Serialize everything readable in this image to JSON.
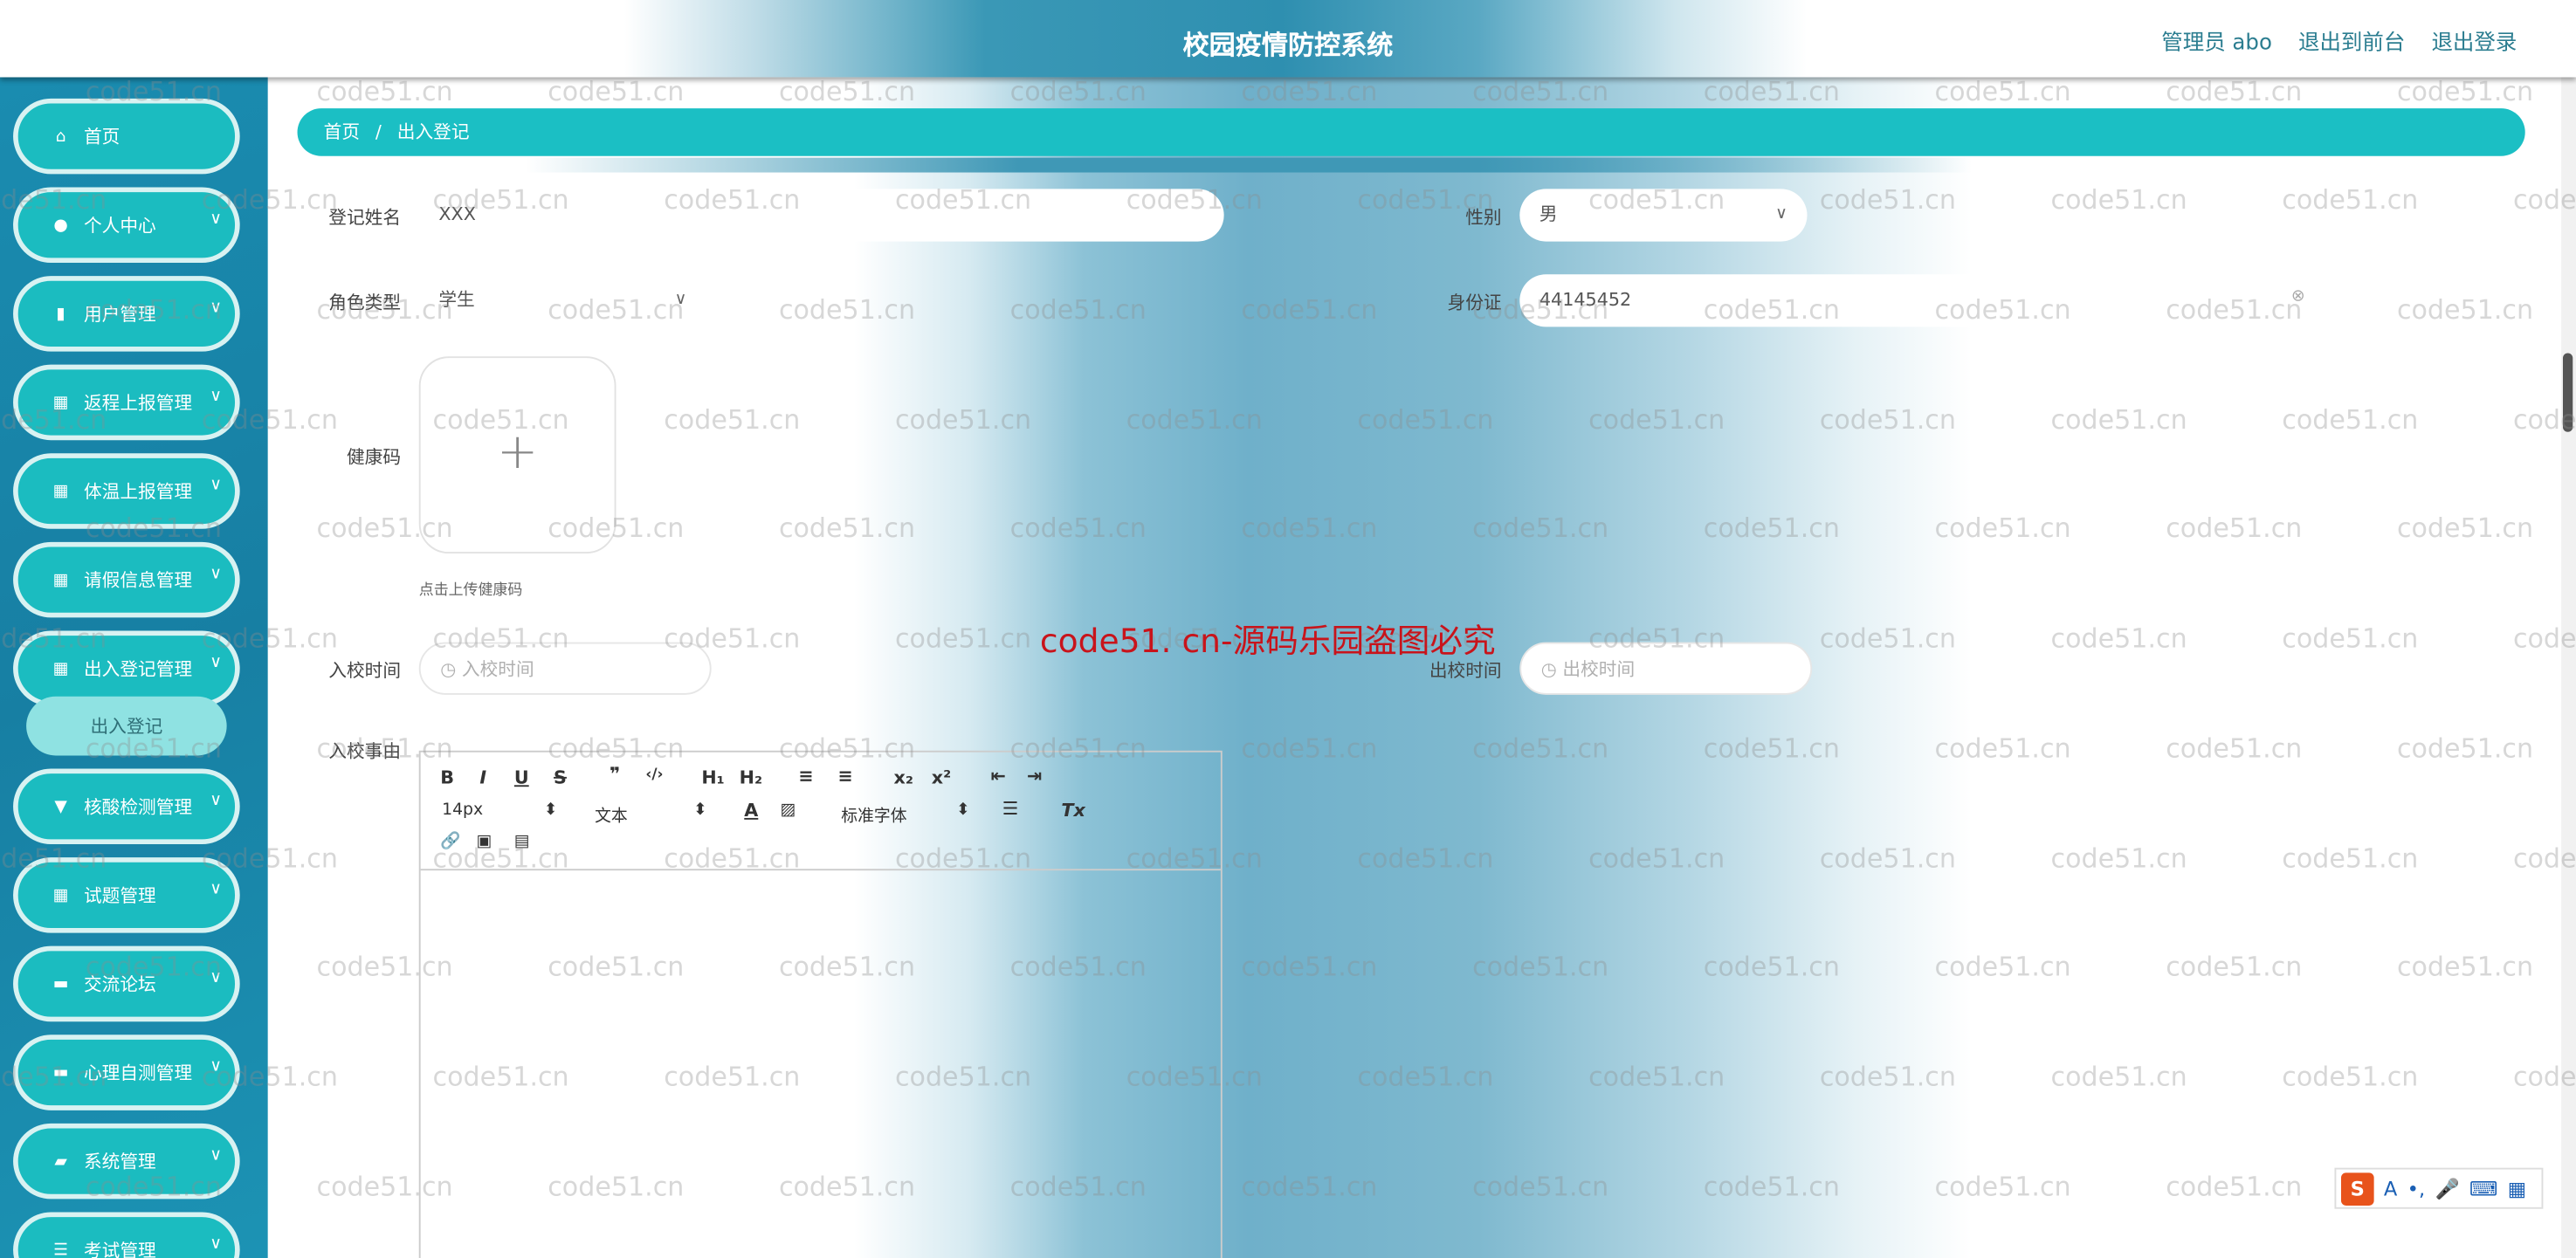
{
  "header": {
    "title": "校园疫情防控系统",
    "user": "管理员 abo",
    "to_front": "退出到前台",
    "logout": "退出登录"
  },
  "sidebar": {
    "items": [
      {
        "label": "首页",
        "icon": "home-icon",
        "glyph": "⌂",
        "chev": false
      },
      {
        "label": "个人中心",
        "icon": "user-icon",
        "glyph": "●",
        "chev": true
      },
      {
        "label": "用户管理",
        "icon": "clipboard-icon",
        "glyph": "▮",
        "chev": true
      },
      {
        "label": "返程上报管理",
        "icon": "grid-icon",
        "glyph": "▦",
        "chev": true
      },
      {
        "label": "体温上报管理",
        "icon": "grid-icon",
        "glyph": "▦",
        "chev": true
      },
      {
        "label": "请假信息管理",
        "icon": "grid-icon",
        "glyph": "▦",
        "chev": true
      },
      {
        "label": "出入登记管理",
        "icon": "grid-icon",
        "glyph": "▦",
        "chev": true
      },
      {
        "label": "核酸检测管理",
        "icon": "test-tube-icon",
        "glyph": "▼",
        "chev": true
      },
      {
        "label": "试题管理",
        "icon": "grid-icon",
        "glyph": "▦",
        "chev": true
      },
      {
        "label": "交流论坛",
        "icon": "forum-icon",
        "glyph": "▬",
        "chev": true
      },
      {
        "label": "心理自测管理",
        "icon": "chat-icon",
        "glyph": "▬",
        "chev": true
      },
      {
        "label": "系统管理",
        "icon": "briefcase-icon",
        "glyph": "▰",
        "chev": true
      },
      {
        "label": "考试管理",
        "icon": "list-icon",
        "glyph": "☰",
        "chev": true
      }
    ],
    "sub_item": "出入登记"
  },
  "breadcrumb": {
    "home": "首页",
    "sep": "/",
    "current": "出入登记"
  },
  "form": {
    "name_label": "登记姓名",
    "name_value": "XXX",
    "gender_label": "性别",
    "gender_value": "男",
    "role_label": "角色类型",
    "role_value": "学生",
    "id_label": "身份证",
    "id_value": "44145452",
    "health_label": "健康码",
    "health_hint": "点击上传健康码",
    "upload_plus": "+",
    "in_time_label": "入校时间",
    "in_time_placeholder": "入校时间",
    "out_time_label": "出校时间",
    "out_time_placeholder": "出校时间",
    "reason_label": "入校事由"
  },
  "editor": {
    "font_size": "14px",
    "block": "文本",
    "font": "标准字体"
  },
  "watermark": {
    "text": "code51.cn",
    "red": "code51. cn-源码乐园盗图必究"
  },
  "ime": {
    "logo": "S",
    "items": [
      "A",
      "•,",
      "🎤",
      "⌨",
      "▦"
    ]
  },
  "colors": {
    "accent": "#1bbcc0",
    "sidebar": "#1a86a8",
    "red_watermark": "#c8141b"
  }
}
